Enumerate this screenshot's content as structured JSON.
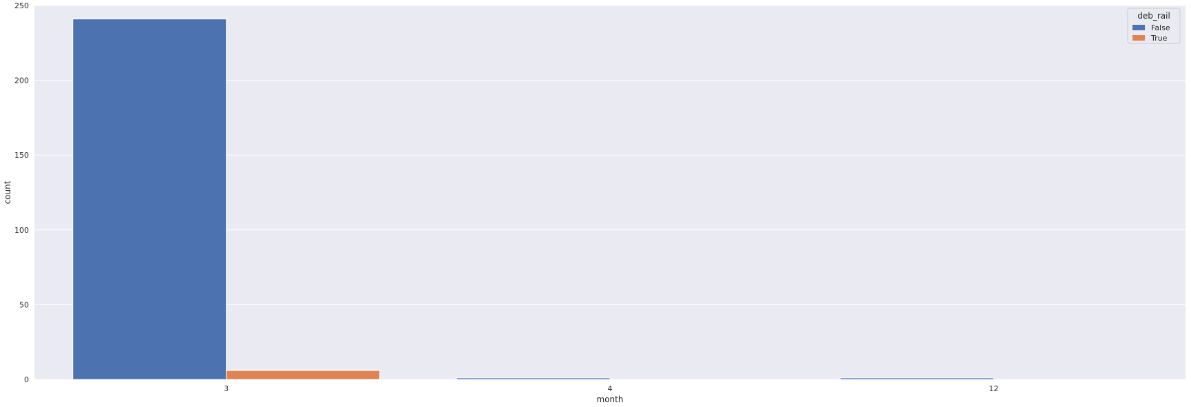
{
  "chart_data": {
    "type": "bar",
    "title": "",
    "xlabel": "month",
    "ylabel": "count",
    "categories": [
      "3",
      "4",
      "12"
    ],
    "ylim": [
      0,
      250
    ],
    "yticks": [
      0,
      50,
      100,
      150,
      200,
      250
    ],
    "grid": true,
    "legend": {
      "title": "deb_rail",
      "placement": "top-right"
    },
    "series": [
      {
        "name": "False",
        "values": [
          241,
          1,
          1
        ],
        "color": "#4C72B0"
      },
      {
        "name": "True",
        "values": [
          6,
          0,
          0
        ],
        "color": "#DD8452"
      }
    ],
    "colors": {
      "plot_background": "#EAEAF2",
      "grid": "#FFFFFF"
    }
  }
}
